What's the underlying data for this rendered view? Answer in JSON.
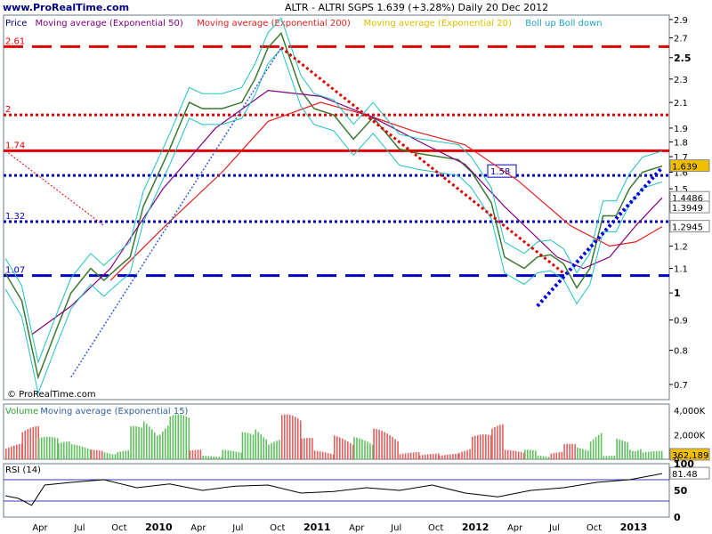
{
  "header": {
    "site": "www.ProRealTime.com",
    "title": "ALTR - ALTRI SGPS    1.639 (+3.28%)   Daily  20 Dec 2012"
  },
  "colors": {
    "price": "#3a7a30",
    "ema50": "#800080",
    "ema200": "#e02020",
    "ema20": "#d8c000",
    "boll": "#20c0c0",
    "level": "#e00000",
    "support": "#0000c0",
    "volume_up": "#60c060",
    "volume_down": "#e06060",
    "rsi": "#000000",
    "panel_bg": "#ffffff",
    "frame": "#6a7a8a"
  },
  "chart_data": [
    {
      "type": "line",
      "panel": "price",
      "legend": [
        {
          "text": "Price",
          "color": "#000080"
        },
        {
          "text": "Moving average (Exponential 50)",
          "color": "#800080"
        },
        {
          "text": "Moving average (Exponential 200)",
          "color": "#e02020"
        },
        {
          "text": "Moving average (Exponential 20)",
          "color": "#d8c000"
        },
        {
          "text": "Boll up Boll down",
          "color": "#20a0c0"
        }
      ],
      "watermark": "© ProRealTime.com",
      "ylim": [
        0.66,
        2.95
      ],
      "yscale": "log",
      "yticks": [
        "2.9",
        "2.7",
        "2.5",
        "2.3",
        "2.1",
        "1.9",
        "1.8",
        "1.7",
        "1.6",
        "1.5",
        "1.4",
        "1.3",
        "1.2",
        "1.1",
        "1",
        "0.9",
        "0.8",
        "0.7"
      ],
      "x_axis": [
        "Apr",
        "Jul",
        "Oct",
        "2010",
        "Apr",
        "Jul",
        "Oct",
        "2011",
        "Apr",
        "Jul",
        "Oct",
        "2012",
        "Apr",
        "Jul",
        "Oct",
        "2013"
      ],
      "levels": [
        {
          "label": "2.61",
          "value": 2.61,
          "style": "dashed",
          "color": "#e00000"
        },
        {
          "label": "2",
          "value": 2.0,
          "style": "dotted",
          "color": "#e00000"
        },
        {
          "label": "1.74",
          "value": 1.74,
          "style": "solid",
          "color": "#e00000"
        },
        {
          "label": "1.58",
          "value": 1.58,
          "style": "dotted",
          "color": "#0000c0"
        },
        {
          "label": "1.32",
          "value": 1.32,
          "style": "dotted",
          "color": "#0000c0"
        },
        {
          "label": "1.07",
          "value": 1.07,
          "style": "dashed",
          "color": "#0000c0"
        }
      ],
      "value_tags": [
        {
          "text": "1.639",
          "value": 1.639,
          "bg": "#f0c000"
        },
        {
          "text": "1.4486",
          "value": 1.4486,
          "bg": "#ffffff"
        },
        {
          "text": "1.3949",
          "value": 1.3949,
          "bg": "#ffffff"
        },
        {
          "text": "1.2945",
          "value": 1.2945,
          "bg": "#ffffff"
        }
      ],
      "series": [
        {
          "name": "Price",
          "x": [
            0,
            0.025,
            0.05,
            0.08,
            0.1,
            0.13,
            0.15,
            0.17,
            0.19,
            0.21,
            0.25,
            0.28,
            0.3,
            0.33,
            0.36,
            0.38,
            0.4,
            0.42,
            0.45,
            0.47,
            0.5,
            0.53,
            0.56,
            0.6,
            0.63,
            0.66,
            0.69,
            0.71,
            0.74,
            0.76,
            0.79,
            0.81,
            0.83,
            0.85,
            0.87,
            0.89,
            0.91,
            0.93,
            0.95,
            0.97,
            1.0
          ],
          "y": [
            1.08,
            0.97,
            0.72,
            0.88,
            1.0,
            1.1,
            1.05,
            1.1,
            1.15,
            1.4,
            1.75,
            2.1,
            2.05,
            2.05,
            2.1,
            2.3,
            2.6,
            2.75,
            2.2,
            2.05,
            2.0,
            1.82,
            1.98,
            1.75,
            1.72,
            1.7,
            1.68,
            1.6,
            1.42,
            1.15,
            1.1,
            1.15,
            1.16,
            1.12,
            1.02,
            1.1,
            1.35,
            1.35,
            1.5,
            1.6,
            1.639
          ]
        },
        {
          "name": "Moving average (Exponential 200)",
          "x": [
            0.16,
            0.25,
            0.33,
            0.4,
            0.48,
            0.55,
            0.62,
            0.7,
            0.78,
            0.86,
            0.92,
            0.96,
            1.0
          ],
          "y": [
            1.05,
            1.32,
            1.6,
            1.95,
            2.1,
            2.0,
            1.88,
            1.78,
            1.55,
            1.3,
            1.2,
            1.22,
            1.2945
          ]
        },
        {
          "name": "Moving average (Exponential 50)",
          "x": [
            0.04,
            0.1,
            0.16,
            0.24,
            0.32,
            0.4,
            0.48,
            0.56,
            0.64,
            0.7,
            0.76,
            0.84,
            0.88,
            0.92,
            0.96,
            1.0
          ],
          "y": [
            0.85,
            0.95,
            1.1,
            1.5,
            1.9,
            2.2,
            2.15,
            1.98,
            1.78,
            1.65,
            1.4,
            1.15,
            1.1,
            1.15,
            1.3,
            1.4486
          ]
        }
      ]
    },
    {
      "type": "bar",
      "panel": "volume",
      "legend": [
        {
          "text": "Volume",
          "color": "#30a030"
        },
        {
          "text": "Moving average (Exponential 15)",
          "color": "#3060a0"
        }
      ],
      "ylim": [
        0,
        4500000
      ],
      "yticks": [
        "4,000K",
        "2,000K",
        "0"
      ],
      "value_tags": [
        {
          "text": "362,189",
          "value": 362189,
          "bg": "#f0c000"
        }
      ]
    },
    {
      "type": "line",
      "panel": "rsi",
      "legend": [
        {
          "text": "RSI (14)",
          "color": "#000000"
        }
      ],
      "ylim": [
        0,
        100
      ],
      "yticks": [
        "100",
        "50",
        "0"
      ],
      "bands": [
        70,
        30
      ],
      "value_tags": [
        {
          "text": "81.48",
          "value": 81.48,
          "bg": "#ffffff"
        }
      ],
      "series": [
        {
          "name": "RSI (14)",
          "x": [
            0,
            0.02,
            0.04,
            0.06,
            0.1,
            0.15,
            0.2,
            0.25,
            0.3,
            0.35,
            0.4,
            0.45,
            0.5,
            0.55,
            0.6,
            0.65,
            0.7,
            0.75,
            0.8,
            0.85,
            0.9,
            0.95,
            1.0
          ],
          "y": [
            40,
            35,
            22,
            60,
            65,
            70,
            55,
            62,
            50,
            58,
            60,
            45,
            48,
            55,
            50,
            60,
            45,
            38,
            50,
            55,
            65,
            70,
            81.48
          ]
        }
      ]
    }
  ]
}
